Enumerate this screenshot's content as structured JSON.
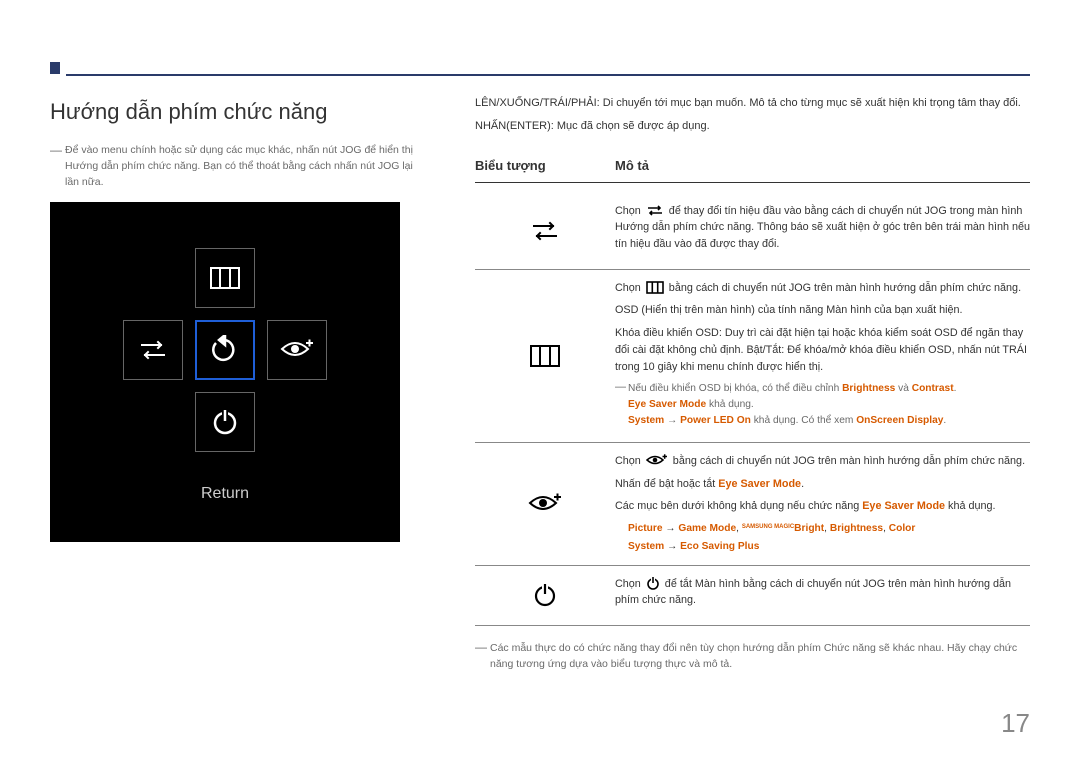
{
  "pageNumber": "17",
  "left": {
    "heading": "Hướng dẫn phím chức năng",
    "note": "Để vào menu chính hoặc sử dụng các mục khác, nhấn nút JOG để hiển thị Hướng dẫn phím chức năng. Bạn có thể thoát bằng cách nhấn nút JOG lại lần nữa.",
    "returnLabel": "Return"
  },
  "right": {
    "intro1": "LÊN/XUỐNG/TRÁI/PHẢI: Di chuyển tới mục bạn muốn. Mô tả cho từng mục sẽ xuất hiện khi trọng tâm thay đổi.",
    "intro2": "NHẤN(ENTER): Mục đã chọn sẽ được áp dụng.",
    "headerIcon": "Biểu tượng",
    "headerDesc": "Mô tả",
    "row1": {
      "p1a": "Chọn ",
      "p1b": " để thay đổi tín hiệu đầu vào bằng cách di chuyển nút JOG trong màn hình Hướng dẫn phím chức năng. Thông báo sẽ xuất hiện ở góc trên bên trái màn hình nếu tín hiệu đầu vào đã được thay đổi."
    },
    "row2": {
      "p1a": "Chọn ",
      "p1b": " bằng cách di chuyển nút JOG trên màn hình hướng dẫn phím chức năng.",
      "p2": "OSD (Hiển thị trên màn hình) của tính năng Màn hình của bạn xuất hiện.",
      "p3": "Khóa điều khiển OSD: Duy trì cài đặt hiện tại hoặc khóa kiểm soát OSD để ngăn thay đổi cài đặt không chủ định. Bật/Tắt: Để khóa/mở khóa điều khiển OSD, nhấn nút TRÁI trong 10 giây khi menu chính được hiển thị.",
      "note1a": "Nếu điều khiển OSD bị khóa, có thể điều chỉnh ",
      "note1_brightness": "Brightness",
      "note1_and": " và ",
      "note1_contrast": "Contrast",
      "note1_period": ".",
      "note1b_mode": "Eye Saver Mode",
      "note1b_rest": " khả dụng.",
      "note1c_sys": "System",
      "note1c_arrow": " → ",
      "note1c_led": "Power LED On",
      "note1c_mid": " khả dụng. Có thể xem ",
      "note1c_osd": "OnScreen Display",
      "note1c_end": "."
    },
    "row3": {
      "p1a": "Chọn ",
      "p1b": " bằng cách di chuyển nút JOG trên màn hình hướng dẫn phím chức năng.",
      "p2a": "Nhấn để bật hoặc tắt ",
      "p2_mode": "Eye Saver Mode",
      "p2b": ".",
      "p3a": "Các mục bên dưới không khả dụng nếu chức năng ",
      "p3_mode": "Eye Saver Mode",
      "p3b": " khả dụng.",
      "line1_pic": "Picture",
      "line1_arrow": " → ",
      "line1_game": "Game Mode",
      "line1_sep": ", ",
      "line1_magic": "SAMSUNG MAGIC",
      "line1_bright1": "Bright",
      "line1_brightness": "Brightness",
      "line1_color": "Color",
      "line2_sys": "System",
      "line2_arrow": " → ",
      "line2_eco": "Eco Saving Plus"
    },
    "row4": {
      "p1a": "Chọn ",
      "p1b": " để tắt Màn hình bằng cách di chuyển nút JOG trên màn hình hướng dẫn phím chức năng."
    },
    "footnote": "Các mẫu thực do có chức năng thay đổi nên tùy chọn hướng dẫn phím Chức năng sẽ khác nhau. Hãy chạy chức năng tương ứng dựa vào biểu tượng thực và mô tả."
  }
}
